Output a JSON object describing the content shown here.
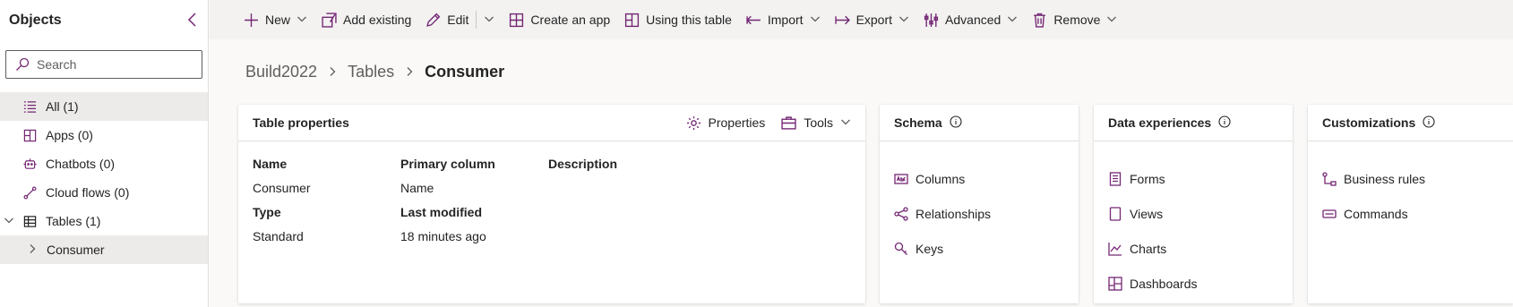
{
  "sidebar": {
    "title": "Objects",
    "search_placeholder": "Search",
    "items": [
      {
        "label": "All (1)"
      },
      {
        "label": "Apps (0)"
      },
      {
        "label": "Chatbots (0)"
      },
      {
        "label": "Cloud flows (0)"
      },
      {
        "label": "Tables (1)"
      },
      {
        "label": "Consumer"
      }
    ]
  },
  "toolbar": {
    "new": "New",
    "add_existing": "Add existing",
    "edit": "Edit",
    "create_app": "Create an app",
    "using_table": "Using this table",
    "import": "Import",
    "export": "Export",
    "advanced": "Advanced",
    "remove": "Remove"
  },
  "breadcrumb": {
    "items": [
      "Build2022",
      "Tables"
    ],
    "current": "Consumer"
  },
  "table_properties": {
    "title": "Table properties",
    "properties_label": "Properties",
    "tools_label": "Tools",
    "fields": {
      "name_label": "Name",
      "name_value": "Consumer",
      "primary_label": "Primary column",
      "primary_value": "Name",
      "description_label": "Description",
      "type_label": "Type",
      "type_value": "Standard",
      "modified_label": "Last modified",
      "modified_value": "18 minutes ago"
    }
  },
  "schema": {
    "title": "Schema",
    "items": [
      {
        "label": "Columns"
      },
      {
        "label": "Relationships"
      },
      {
        "label": "Keys"
      }
    ]
  },
  "data_experiences": {
    "title": "Data experiences",
    "items": [
      {
        "label": "Forms"
      },
      {
        "label": "Views"
      },
      {
        "label": "Charts"
      },
      {
        "label": "Dashboards"
      }
    ]
  },
  "customizations": {
    "title": "Customizations",
    "items": [
      {
        "label": "Business rules"
      },
      {
        "label": "Commands"
      }
    ]
  },
  "colors": {
    "accent": "#742774",
    "selected_bg": "#edebe9",
    "toolbar_bg": "#f3f2f1"
  }
}
